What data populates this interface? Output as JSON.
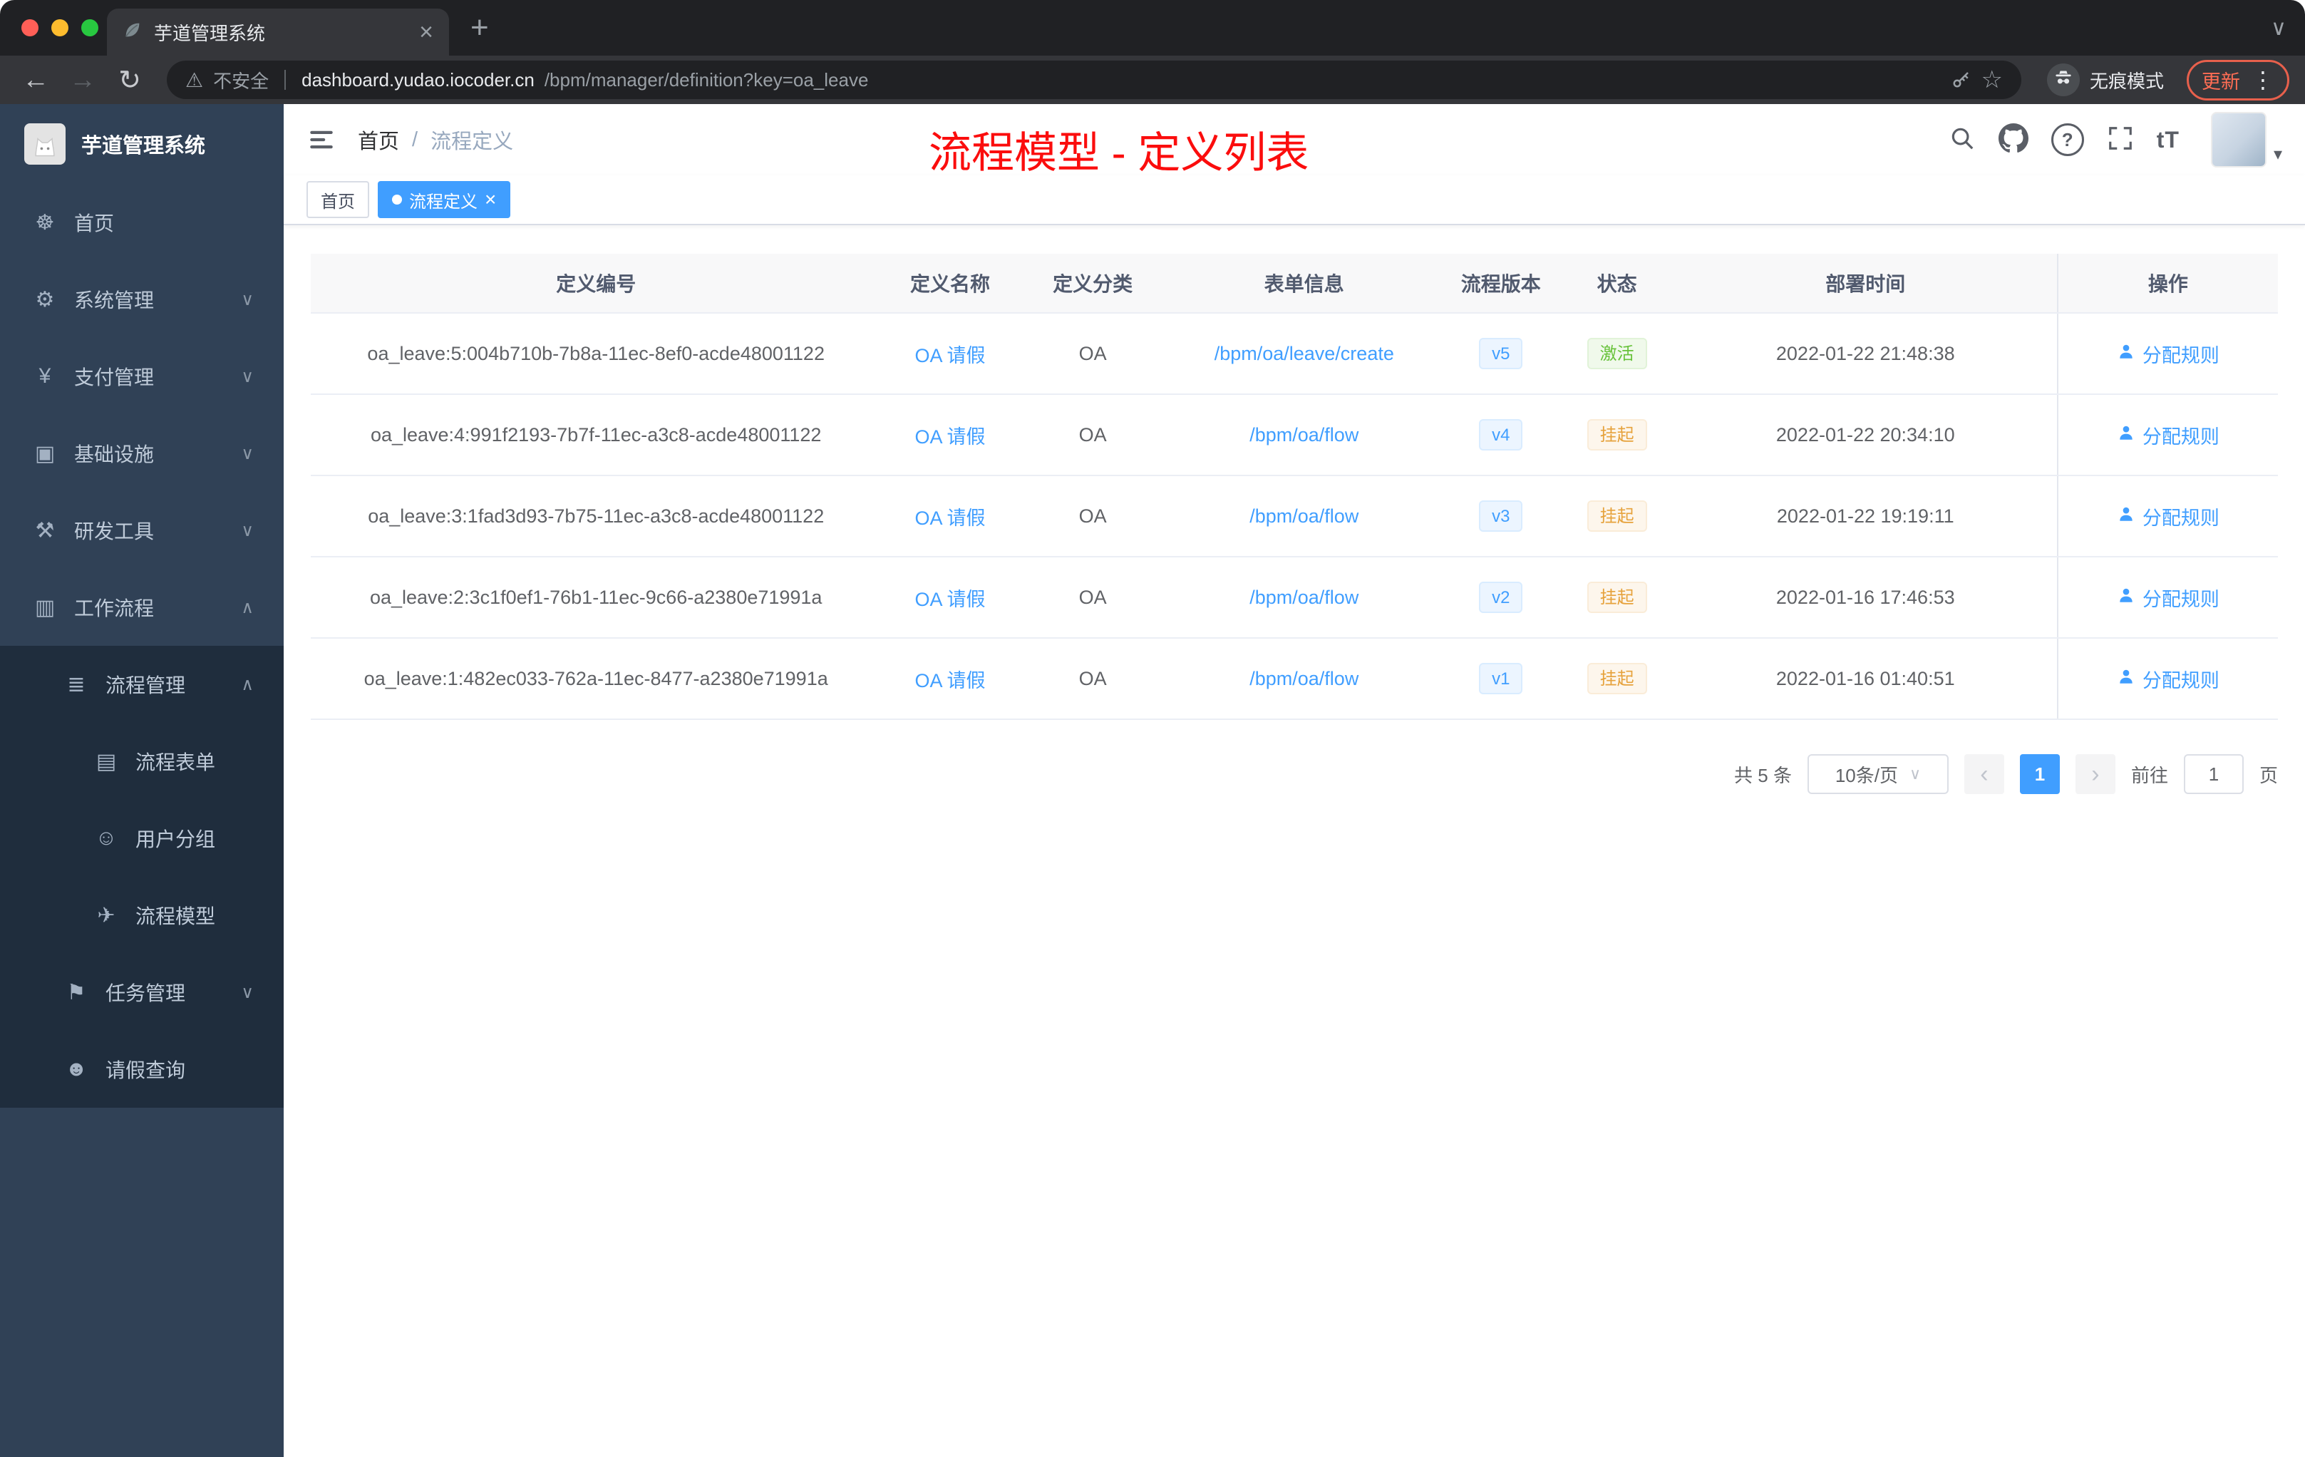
{
  "browser": {
    "tab_title": "芋道管理系统",
    "security_label": "不安全",
    "url_host": "dashboard.yudao.iocoder.cn",
    "url_path": "/bpm/manager/definition?key=oa_leave",
    "incognito_label": "无痕模式",
    "update_label": "更新"
  },
  "sidebar": {
    "app_title": "芋道管理系统",
    "menu": [
      {
        "label": "首页",
        "icon": "home",
        "level": 1,
        "sub": false
      },
      {
        "label": "系统管理",
        "icon": "system",
        "level": 1,
        "sub": false,
        "chevron": "down"
      },
      {
        "label": "支付管理",
        "icon": "pay",
        "level": 1,
        "sub": false,
        "chevron": "down"
      },
      {
        "label": "基础设施",
        "icon": "infra",
        "level": 1,
        "sub": false,
        "chevron": "down"
      },
      {
        "label": "研发工具",
        "icon": "dev",
        "level": 1,
        "sub": false,
        "chevron": "down"
      },
      {
        "label": "工作流程",
        "icon": "workflow",
        "level": 1,
        "sub": false,
        "chevron": "up"
      },
      {
        "label": "流程管理",
        "icon": "process",
        "level": 2,
        "sub": true,
        "chevron": "up"
      },
      {
        "label": "流程表单",
        "icon": "form",
        "level": 3,
        "sub": true
      },
      {
        "label": "用户分组",
        "icon": "users",
        "level": 3,
        "sub": true
      },
      {
        "label": "流程模型",
        "icon": "model",
        "level": 3,
        "sub": true
      },
      {
        "label": "任务管理",
        "icon": "task",
        "level": 2,
        "sub": true,
        "chevron": "down"
      },
      {
        "label": "请假查询",
        "icon": "person",
        "level": 2,
        "sub": true
      }
    ]
  },
  "header": {
    "breadcrumb": [
      "首页",
      "流程定义"
    ],
    "breadcrumb_separator": "/",
    "annotation": "流程模型 - 定义列表"
  },
  "tags": [
    {
      "label": "首页",
      "active": false
    },
    {
      "label": "流程定义",
      "active": true
    }
  ],
  "table": {
    "columns": [
      "定义编号",
      "定义名称",
      "定义分类",
      "表单信息",
      "流程版本",
      "状态",
      "部署时间",
      "操作"
    ],
    "rows": [
      {
        "id": "oa_leave:5:004b710b-7b8a-11ec-8ef0-acde48001122",
        "name": "OA 请假",
        "category": "OA",
        "form": "/bpm/oa/leave/create",
        "version": "v5",
        "status": "激活",
        "status_type": "success",
        "deploy_time": "2022-01-22 21:48:38",
        "action": "分配规则"
      },
      {
        "id": "oa_leave:4:991f2193-7b7f-11ec-a3c8-acde48001122",
        "name": "OA 请假",
        "category": "OA",
        "form": "/bpm/oa/flow",
        "version": "v4",
        "status": "挂起",
        "status_type": "warning",
        "deploy_time": "2022-01-22 20:34:10",
        "action": "分配规则"
      },
      {
        "id": "oa_leave:3:1fad3d93-7b75-11ec-a3c8-acde48001122",
        "name": "OA 请假",
        "category": "OA",
        "form": "/bpm/oa/flow",
        "version": "v3",
        "status": "挂起",
        "status_type": "warning",
        "deploy_time": "2022-01-22 19:19:11",
        "action": "分配规则"
      },
      {
        "id": "oa_leave:2:3c1f0ef1-76b1-11ec-9c66-a2380e71991a",
        "name": "OA 请假",
        "category": "OA",
        "form": "/bpm/oa/flow",
        "version": "v2",
        "status": "挂起",
        "status_type": "warning",
        "deploy_time": "2022-01-16 17:46:53",
        "action": "分配规则"
      },
      {
        "id": "oa_leave:1:482ec033-762a-11ec-8477-a2380e71991a",
        "name": "OA 请假",
        "category": "OA",
        "form": "/bpm/oa/flow",
        "version": "v1",
        "status": "挂起",
        "status_type": "warning",
        "deploy_time": "2022-01-16 01:40:51",
        "action": "分配规则"
      }
    ]
  },
  "pagination": {
    "total_label": "共 5 条",
    "page_size_label": "10条/页",
    "current_page": "1",
    "goto_label": "前往",
    "goto_value": "1",
    "unit_label": "页"
  },
  "colors": {
    "accent": "#409eff",
    "annotation_red": "#fb0d0d",
    "status_active_green": "#67c23a",
    "status_suspend_yellow": "#e6a23c",
    "sidebar_bg": "#304156",
    "submenu_bg": "#1f2d3d"
  }
}
